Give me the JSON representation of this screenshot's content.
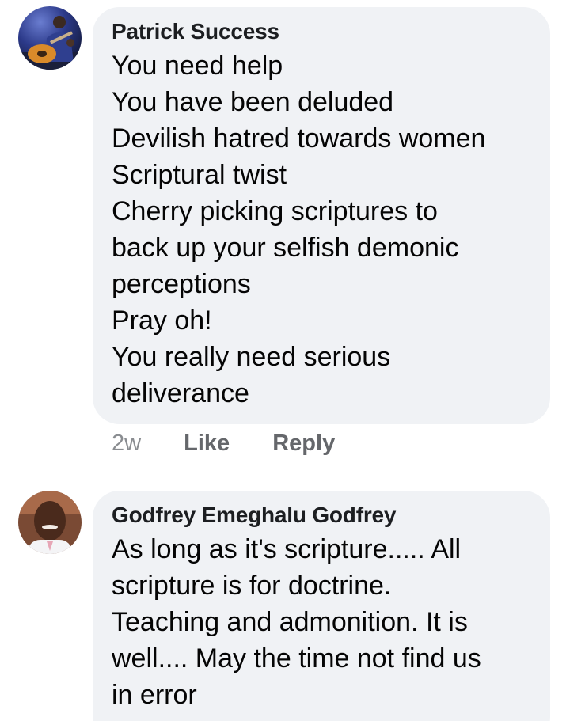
{
  "comments": [
    {
      "author": "Patrick Success",
      "lines": [
        "You need help",
        "You have been deluded",
        "Devilish hatred towards women",
        "Scriptural twist",
        "Cherry picking scriptures to",
        "back up your selfish demonic",
        "perceptions",
        "Pray oh!",
        "You really need serious",
        "deliverance"
      ],
      "timestamp": "2w",
      "like_label": "Like",
      "reply_label": "Reply",
      "avatar_icon": "avatar-guitarist-photo"
    },
    {
      "author": "Godfrey Emeghalu Godfrey",
      "lines": [
        "As long as it's scripture.....  All",
        "scripture is for doctrine.",
        "Teaching and admonition.  It is",
        "well....  May the time not find us",
        "in error"
      ],
      "avatar_icon": "avatar-person-photo"
    }
  ],
  "colors": {
    "bubble_bg": "#f0f2f5",
    "author_text": "#1c1e21",
    "body_text": "#050505",
    "meta_text": "#65676b"
  }
}
